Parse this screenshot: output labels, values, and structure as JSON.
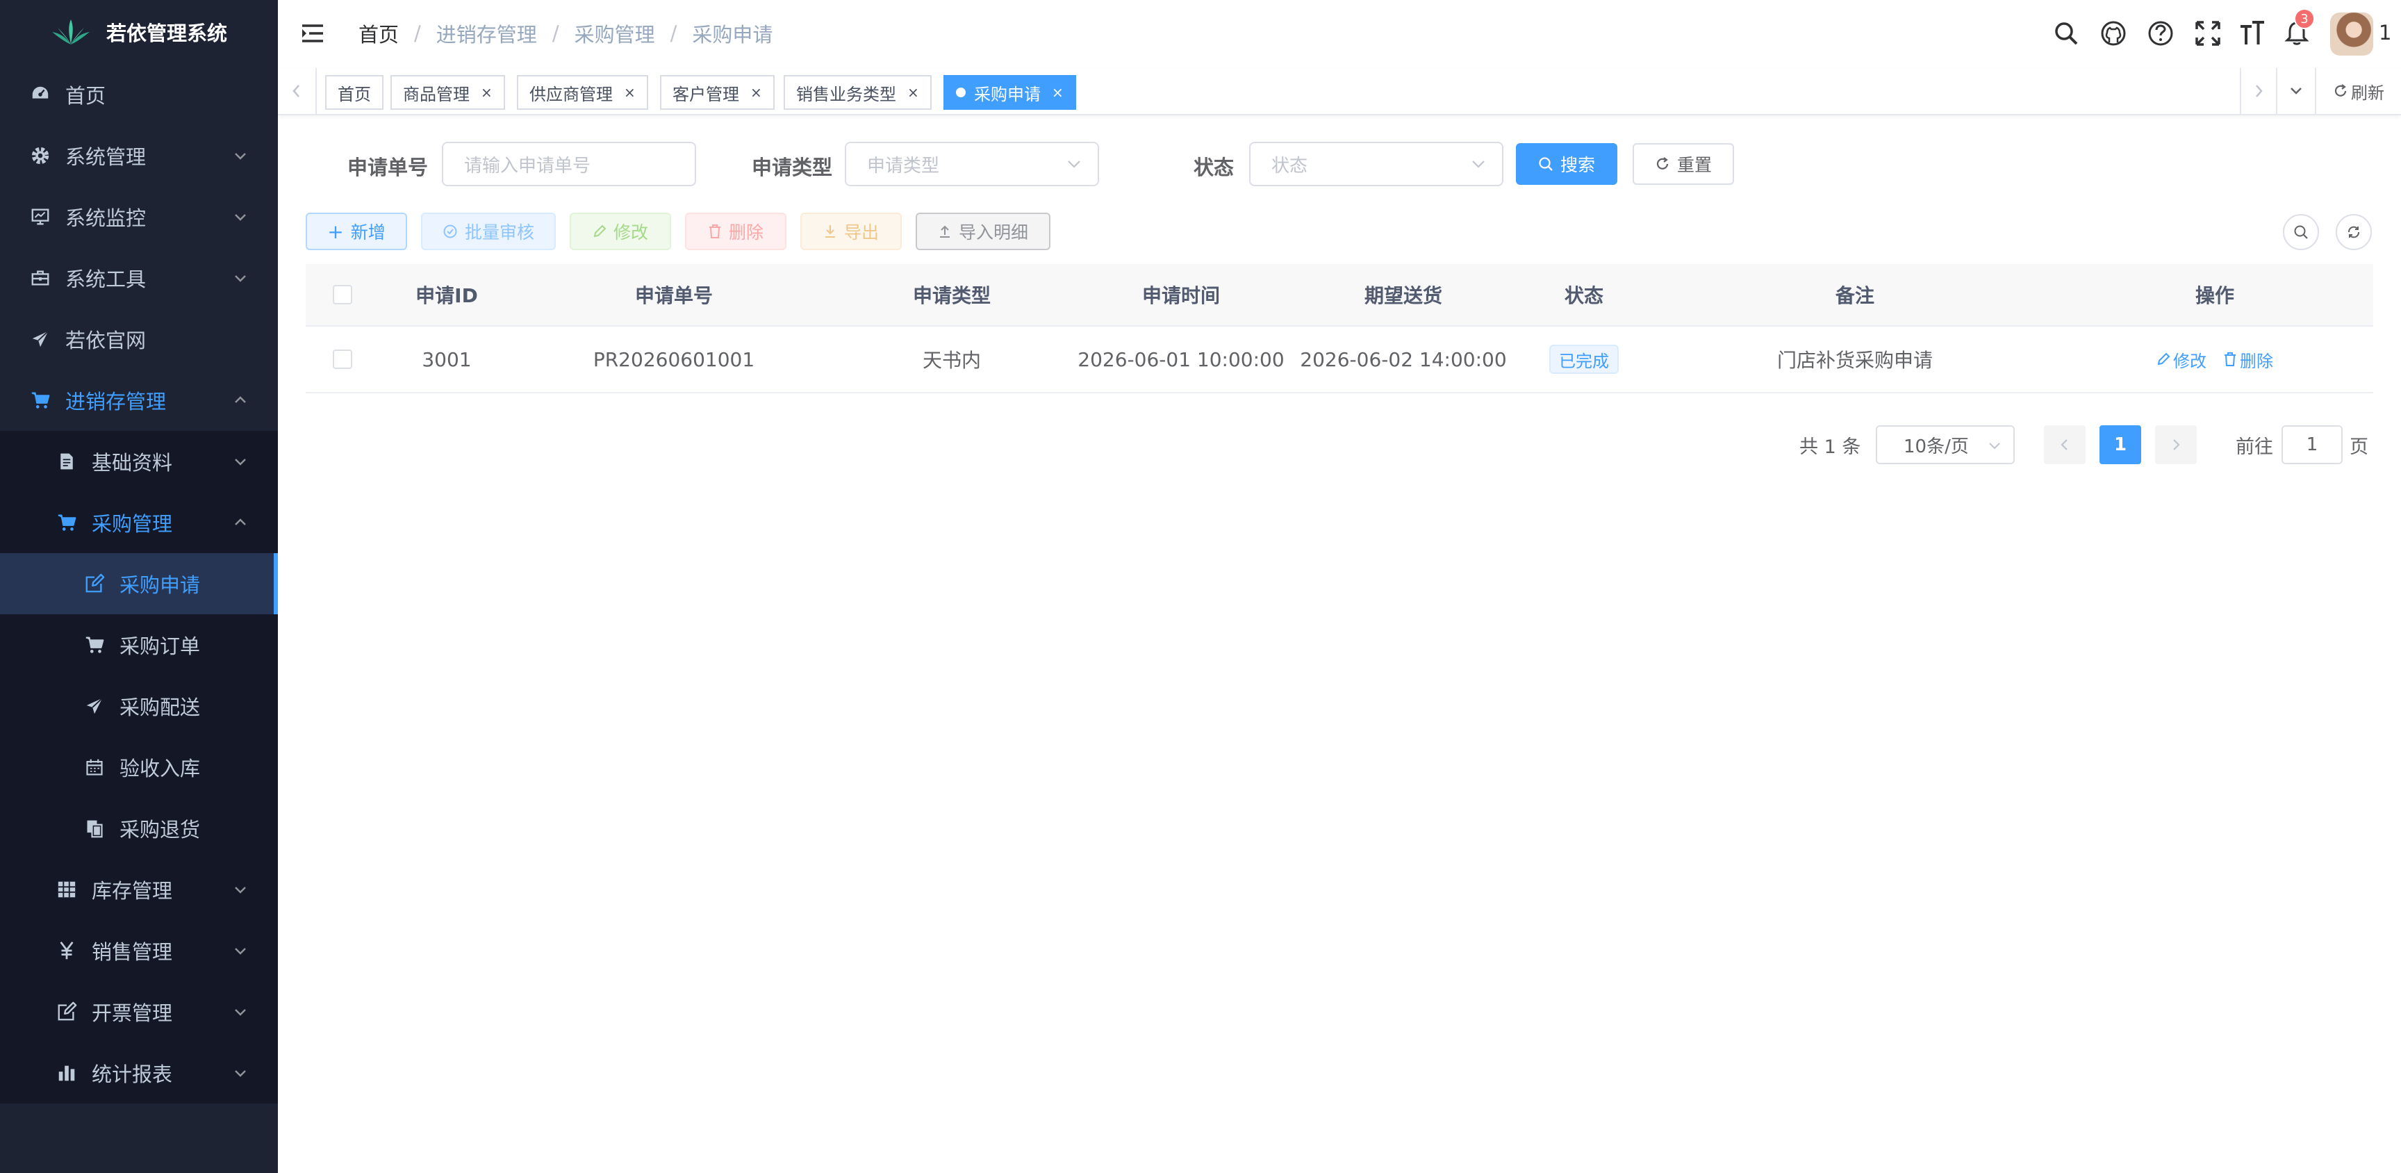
{
  "app": {
    "title": "若依管理系统"
  },
  "colors": {
    "sidebar_bg": "#1e2334",
    "accent": "#409eff",
    "danger": "#f56c6c"
  },
  "sidebar": {
    "items": [
      {
        "label": "首页",
        "icon": "dashboard-icon",
        "level": 1
      },
      {
        "label": "系统管理",
        "icon": "gear-icon",
        "level": 1,
        "expandable": true
      },
      {
        "label": "系统监控",
        "icon": "monitor-icon",
        "level": 1,
        "expandable": true
      },
      {
        "label": "系统工具",
        "icon": "toolbox-icon",
        "level": 1,
        "expandable": true
      },
      {
        "label": "若依官网",
        "icon": "paper-plane-icon",
        "level": 1
      },
      {
        "label": "进销存管理",
        "icon": "cart-icon",
        "level": 1,
        "expanded": true
      },
      {
        "label": "基础资料",
        "icon": "document-icon",
        "level": 2,
        "expandable": true
      },
      {
        "label": "采购管理",
        "icon": "cart-icon",
        "level": 2,
        "expanded": true
      },
      {
        "label": "采购申请",
        "icon": "edit-icon",
        "level": 3,
        "selected": true
      },
      {
        "label": "采购订单",
        "icon": "cart-icon",
        "level": 3
      },
      {
        "label": "采购配送",
        "icon": "paper-plane-icon",
        "level": 3
      },
      {
        "label": "验收入库",
        "icon": "calendar-icon",
        "level": 3
      },
      {
        "label": "采购退货",
        "icon": "copy-icon",
        "level": 3
      },
      {
        "label": "库存管理",
        "icon": "grid-icon",
        "level": 2,
        "expandable": true
      },
      {
        "label": "销售管理",
        "icon": "yen-icon",
        "level": 2,
        "expandable": true
      },
      {
        "label": "开票管理",
        "icon": "edit-icon",
        "level": 2,
        "expandable": true
      },
      {
        "label": "统计报表",
        "icon": "bar-chart-icon",
        "level": 2,
        "expandable": true
      }
    ]
  },
  "navbar": {
    "breadcrumb": [
      "首页",
      "进销存管理",
      "采购管理",
      "采购申请"
    ],
    "notification_count": "3",
    "user_label": "1"
  },
  "tags": [
    {
      "label": "首页",
      "closable": false
    },
    {
      "label": "商品管理",
      "closable": true
    },
    {
      "label": "供应商管理",
      "closable": true
    },
    {
      "label": "客户管理",
      "closable": true
    },
    {
      "label": "销售业务类型",
      "closable": true
    },
    {
      "label": "采购申请",
      "closable": true,
      "active": true
    }
  ],
  "tags_refresh_label": "刷新",
  "search_form": {
    "apply_no_label": "申请单号",
    "apply_no_placeholder": "请输入申请单号",
    "apply_type_label": "申请类型",
    "apply_type_placeholder": "申请类型",
    "status_label": "状态",
    "status_placeholder": "状态",
    "search_button": "搜索",
    "reset_button": "重置"
  },
  "toolbar": {
    "add": "新增",
    "batch_audit": "批量审核",
    "edit": "修改",
    "delete": "删除",
    "export": "导出",
    "import_detail": "导入明细"
  },
  "table": {
    "columns": [
      "申请ID",
      "申请单号",
      "申请类型",
      "申请时间",
      "期望送货",
      "状态",
      "备注",
      "操作"
    ],
    "rows": [
      {
        "id": "3001",
        "apply_no": "PR20260601001",
        "apply_type": "天书内",
        "apply_time": "2026-06-01 10:00:00",
        "expected_delivery": "2026-06-02 14:00:00",
        "status": "已完成",
        "remark": "门店补货采购申请",
        "op_edit": "修改",
        "op_delete": "删除"
      }
    ]
  },
  "pagination": {
    "total_text": "共 1 条",
    "page_size": "10条/页",
    "current_page": "1",
    "goto_label": "前往",
    "goto_value": "1",
    "page_suffix": "页"
  }
}
